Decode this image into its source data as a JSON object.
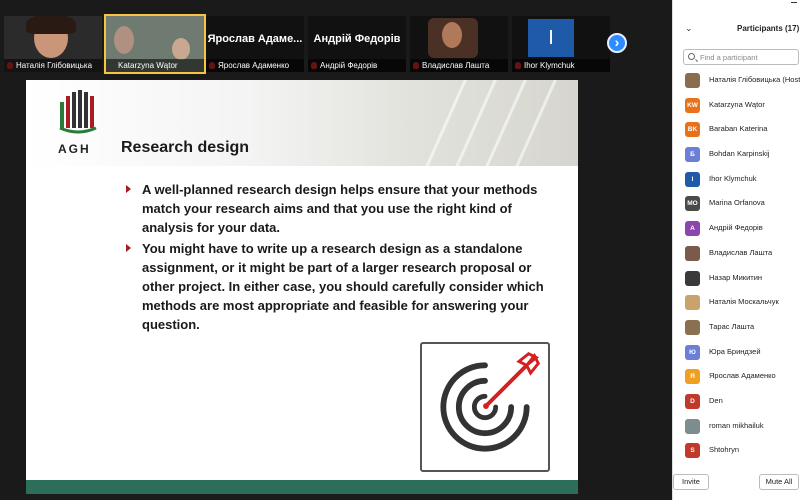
{
  "thumbnails": [
    {
      "name": "Наталія Глібовицька",
      "big_name": "",
      "active": false
    },
    {
      "name": "Katarzyna Wątor",
      "big_name": "",
      "active": true
    },
    {
      "name": "Ярослав Адаменко",
      "big_name": "Ярослав Адаме...",
      "active": false
    },
    {
      "name": "Андрій Федорів",
      "big_name": "Андрій Федорів",
      "active": false
    },
    {
      "name": "Владислав Лашта",
      "big_name": "",
      "active": false
    },
    {
      "name": "Ihor Klymchuk",
      "big_name": "I",
      "active": false
    }
  ],
  "next_button": "›",
  "slide": {
    "logo_text": "AGH",
    "title": "Research design",
    "bullets": [
      "A well-planned research design helps ensure that your methods match your research aims and that you use the right kind of analysis for your data.",
      "You might have to write up a research design as a standalone assignment, or it might be part of a larger research proposal or other project. In either case, you should carefully consider which methods are most appropriate and feasible for answering your question."
    ],
    "image_icon": "target-arrow-icon",
    "colors": {
      "accent": "#a61e22",
      "footer": "#2d6e5b"
    }
  },
  "panel": {
    "title": "Participants (17)",
    "search_placeholder": "Find a participant",
    "participants": [
      {
        "name": "Наталія Глібовицька (Host, me)",
        "initials": "",
        "color": "#8a6d4e"
      },
      {
        "name": "Katarzyna Wątor",
        "initials": "KW",
        "color": "#e8711a"
      },
      {
        "name": "Baraban Katerina",
        "initials": "BK",
        "color": "#e8711a"
      },
      {
        "name": "Bohdan Karpinskij",
        "initials": "Б",
        "color": "#6b7fd7"
      },
      {
        "name": "Ihor Klymchuk",
        "initials": "I",
        "color": "#1e5aa8"
      },
      {
        "name": "Marina Orfanova",
        "initials": "MO",
        "color": "#4a4a4a"
      },
      {
        "name": "Андрій Федорів",
        "initials": "А",
        "color": "#8e44ad"
      },
      {
        "name": "Владислав Лашта",
        "initials": "",
        "color": "#7a5a4a"
      },
      {
        "name": "Назар Микитин",
        "initials": "",
        "color": "#3a3a3a"
      },
      {
        "name": "Наталія Москальчук",
        "initials": "",
        "color": "#c9a36b"
      },
      {
        "name": "Тарас Лашта",
        "initials": "",
        "color": "#8a7050"
      },
      {
        "name": "Юра Бриндзей",
        "initials": "Ю",
        "color": "#6b7fd7"
      },
      {
        "name": "Ярослав Адаменко",
        "initials": "Я",
        "color": "#f0a020"
      },
      {
        "name": "Den",
        "initials": "D",
        "color": "#c0392b"
      },
      {
        "name": "roman mikhailuk",
        "initials": "",
        "color": "#7f8c8d"
      },
      {
        "name": "Shtohryn",
        "initials": "S",
        "color": "#c0392b"
      }
    ],
    "invite_label": "Invite",
    "mute_all_label": "Mute All"
  }
}
